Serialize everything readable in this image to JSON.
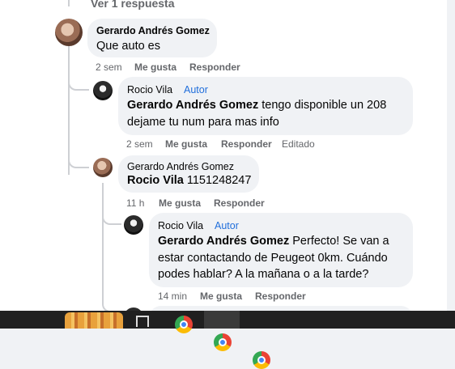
{
  "top_link": "Ver 1 respuesta",
  "comments": [
    {
      "author": "Gerardo Andrés Gomez",
      "text": "Que auto es",
      "time": "2 sem",
      "like": "Me gusta",
      "reply": "Responder"
    },
    {
      "author": "Rocio Vila",
      "badge": "Autor",
      "mention": "Gerardo Andrés Gomez",
      "line1": " tengo disponible un 208",
      "line2": "dejame tu num para mas info",
      "time": "2 sem",
      "like": "Me gusta",
      "reply": "Responder",
      "edited": "Editado"
    },
    {
      "author": "Gerardo Andrés Gomez",
      "mention": "Rocio Vila",
      "text": " 1151248247",
      "time": "11 h",
      "like": "Me gusta",
      "reply": "Responder"
    },
    {
      "author": "Rocio Vila",
      "badge": "Autor",
      "mention": "Gerardo Andrés Gomez",
      "line1": " Perfecto! Se van a",
      "line2": "estar contactando de Peugeot 0km. Cuándo",
      "line3": "podes hablar? A la mañana o a la tarde?",
      "time": "14 min",
      "like": "Me gusta",
      "reply": "Responder"
    }
  ],
  "taskbar": {
    "icons": [
      "flame-app-icon",
      "task-view-icon",
      "chrome-icon",
      "chrome-icon",
      "chrome-icon"
    ]
  }
}
